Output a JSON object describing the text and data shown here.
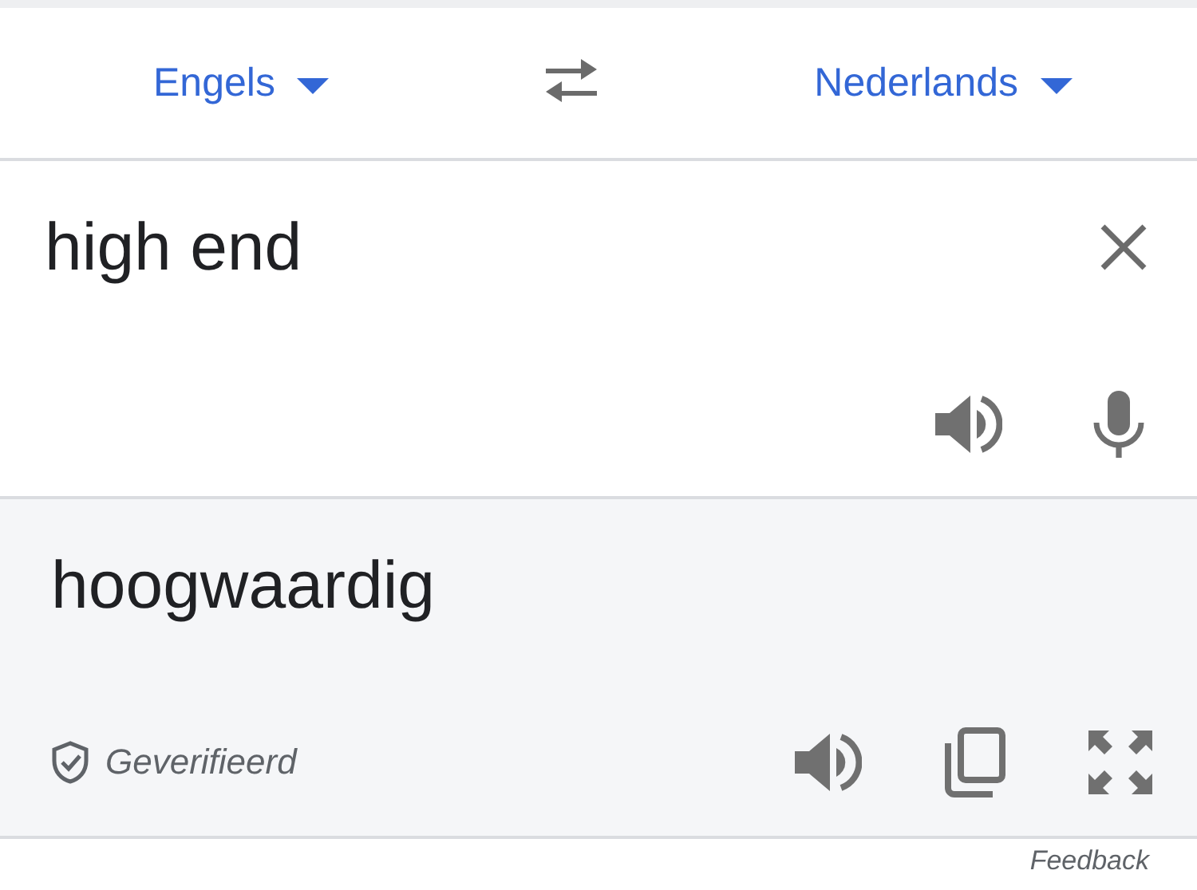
{
  "languages": {
    "source": "Engels",
    "target": "Nederlands"
  },
  "input": {
    "value": "high end"
  },
  "output": {
    "text": "hoogwaardig",
    "verified": true,
    "verified_label": "Geverifieerd"
  },
  "feedback": "Feedback"
}
